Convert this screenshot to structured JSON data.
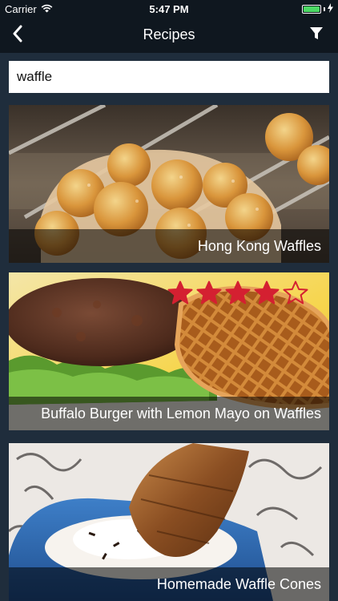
{
  "status_bar": {
    "carrier": "Carrier",
    "time": "5:47 PM",
    "battery_level": 1.0,
    "icons": [
      "wifi-icon",
      "battery-icon",
      "charging-icon"
    ]
  },
  "nav": {
    "title": "Recipes",
    "back_icon": "chevron-left-icon",
    "filter_icon": "filter-icon"
  },
  "search": {
    "value": "waffle"
  },
  "recipes": [
    {
      "title": "Hong Kong Waffles",
      "rating": null
    },
    {
      "title": "Buffalo Burger with Lemon Mayo on Waffles",
      "rating": 4,
      "rating_max": 5
    },
    {
      "title": "Homemade Waffle Cones",
      "rating": null
    }
  ],
  "colors": {
    "background": "#1f2d3c",
    "bars": "#0f171f",
    "star": "#d42031",
    "battery": "#4cd964"
  }
}
